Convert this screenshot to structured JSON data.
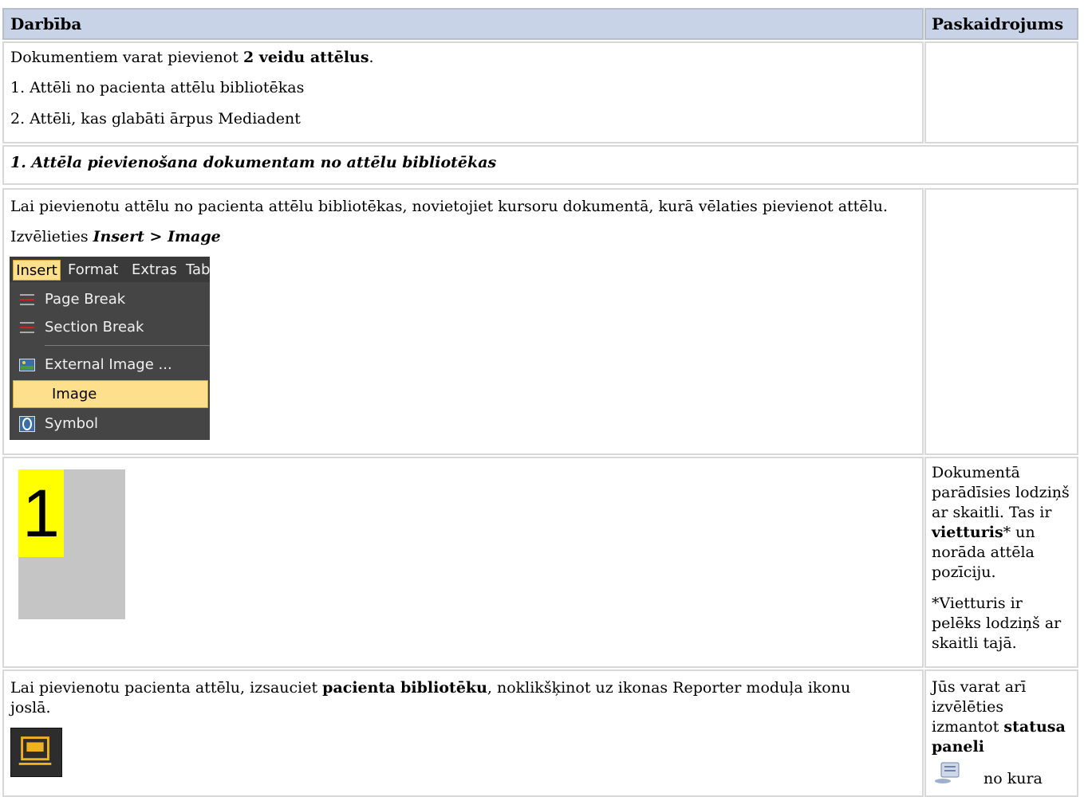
{
  "table": {
    "header_action": "Darbība",
    "header_explanation": "Paskaidrojums"
  },
  "row1": {
    "intro_prefix": "Dokumentiem varat pievienot ",
    "intro_bold": "2 veidu attēlus",
    "intro_suffix": ".",
    "item1": "1. Attēli no pacienta attēlu bibliotēkas",
    "item2": "2. Attēli, kas glabāti ārpus Mediadent"
  },
  "section_title": "1. Attēla pievienošana dokumentam no attēlu bibliotēkas",
  "row3": {
    "instruction": "Lai pievienotu attēlu no pacienta attēlu bibliotēkas, novietojiet kursoru dokumentā, kurā vēlaties pievienot attēlu.",
    "choose_prefix": "Izvēlieties ",
    "choose_path": "Insert > Image"
  },
  "menu": {
    "menubar": [
      "Insert",
      "Format",
      "Extras",
      "Tab"
    ],
    "items": [
      {
        "label": "Page Break",
        "icon": "page-break-icon"
      },
      {
        "label": "Section Break",
        "icon": "section-break-icon"
      },
      {
        "label": "External Image ...",
        "icon": "external-image-icon"
      },
      {
        "label": "Image",
        "icon": "",
        "selected": true
      },
      {
        "label": "Symbol",
        "icon": "symbol-icon"
      }
    ],
    "highlight_color": "#fddf8c"
  },
  "row4": {
    "placeholder_number": "1",
    "side_line1": "Dokumentā parādīsies lodziņš ar skaitli. Tas ir ",
    "side_bold": "vietturis",
    "side_line1_end": "* un norāda attēla pozīciju.",
    "side_note": "*Vietturis ir pelēks lodziņš ar skaitli tajā."
  },
  "row5": {
    "text_prefix": "Lai pievienotu pacienta attēlu, izsauciet ",
    "text_bold": "pacienta bibliotēku",
    "text_suffix": ", noklikšķinot uz ikonas Reporter moduļa ikonu",
    "text_line2": "joslā.",
    "side_prefix": "Jūs varat arī izvēlēties izmantot ",
    "side_bold": "statusa paneli",
    "side_cut": "no kura"
  },
  "colors": {
    "header_bg": "#c8d3e8",
    "placeholder_yellow": "#ffff00",
    "placeholder_gray": "#c5c5c5"
  }
}
